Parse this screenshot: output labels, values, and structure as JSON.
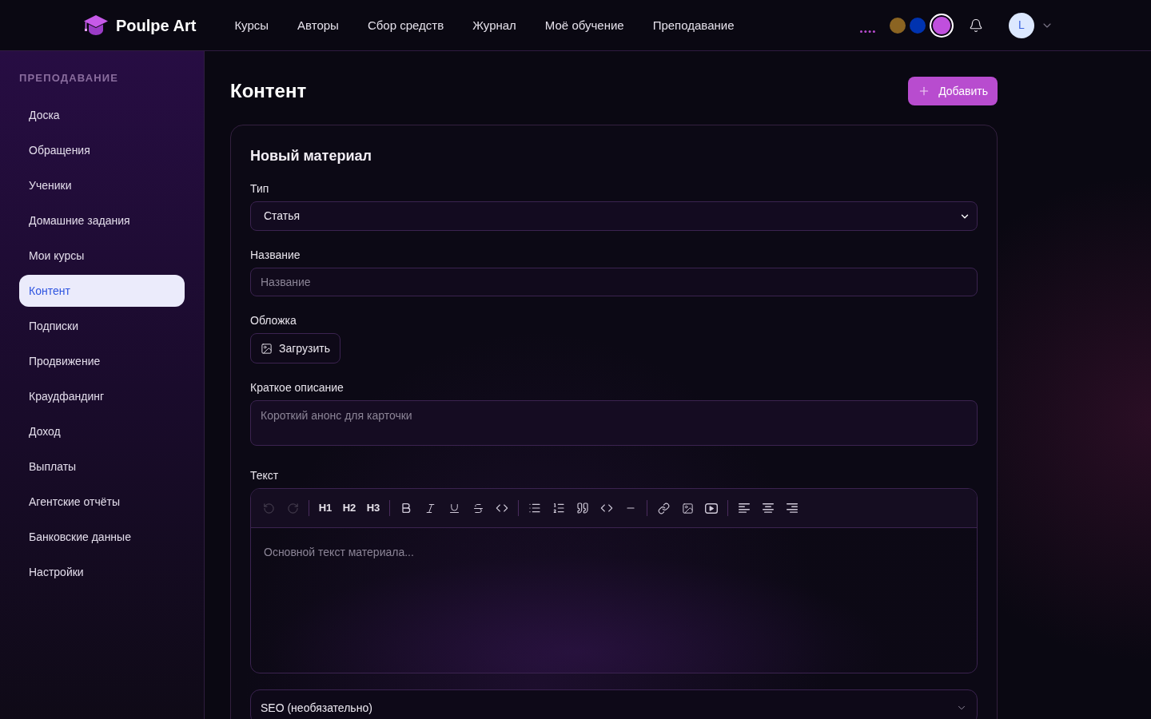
{
  "header": {
    "logo": "Poulpe Art",
    "nav": [
      "Курсы",
      "Авторы",
      "Сбор средств",
      "Журнал",
      "Моё обучение",
      "Преподавание"
    ],
    "theme_swatches": [
      {
        "color": "#8b6422",
        "selected": false
      },
      {
        "color": "#0033b0",
        "selected": false
      },
      {
        "color": "#c04fdd",
        "selected": true
      }
    ],
    "avatar": "L"
  },
  "sidebar": {
    "heading": "ПРЕПОДАВАНИЕ",
    "items": [
      {
        "label": "Доска",
        "selected": false
      },
      {
        "label": "Обращения",
        "selected": false
      },
      {
        "label": "Ученики",
        "selected": false
      },
      {
        "label": "Домашние задания",
        "selected": false
      },
      {
        "label": "Мои курсы",
        "selected": false
      },
      {
        "label": "Контент",
        "selected": true
      },
      {
        "label": "Подписки",
        "selected": false
      },
      {
        "label": "Продвижение",
        "selected": false
      },
      {
        "label": "Краудфандинг",
        "selected": false
      },
      {
        "label": "Доход",
        "selected": false
      },
      {
        "label": "Выплаты",
        "selected": false
      },
      {
        "label": "Агентские отчёты",
        "selected": false
      },
      {
        "label": "Банковские данные",
        "selected": false
      },
      {
        "label": "Настройки",
        "selected": false
      }
    ]
  },
  "page": {
    "title": "Контент",
    "add_button": "Добавить"
  },
  "form": {
    "title": "Новый материал",
    "type": {
      "label": "Тип",
      "value": "Статья"
    },
    "name": {
      "label": "Название",
      "placeholder": "Название"
    },
    "cover": {
      "label": "Обложка",
      "button": "Загрузить"
    },
    "summary": {
      "label": "Краткое описание",
      "placeholder": "Короткий анонс для карточки"
    },
    "text": {
      "label": "Текст",
      "toolbar": {
        "history": [
          {
            "disabled": true
          },
          {
            "disabled": true
          }
        ],
        "headings": [
          "H1",
          "H2",
          "H3"
        ]
      },
      "placeholder": "Основной текст материала..."
    },
    "seo": {
      "label": "SEO (необязательно)"
    }
  }
}
